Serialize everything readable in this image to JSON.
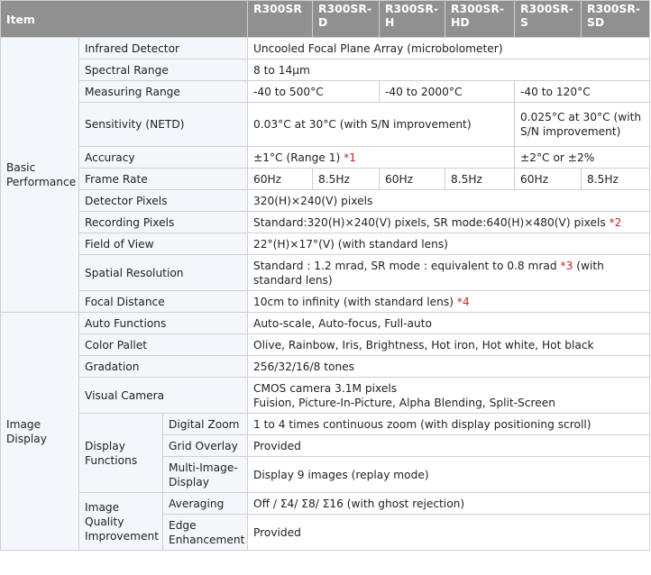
{
  "header": {
    "item": "Item",
    "models": [
      "R300SR",
      "R300SR-D",
      "R300SR-H",
      "R300SR-HD",
      "R300SR-S",
      "R300SR-SD"
    ]
  },
  "basic": {
    "category": "Basic Performance",
    "infrared_detector": {
      "label": "Infrared Detector",
      "value": "Uncooled Focal Plane Array (microbolometer)"
    },
    "spectral_range": {
      "label": "Spectral Range",
      "value": "8 to 14μm"
    },
    "measuring_range": {
      "label": "Measuring Range",
      "v1": "-40 to 500°C",
      "v2": "-40 to 2000°C",
      "v3": "-40 to 120°C"
    },
    "sensitivity": {
      "label": "Sensitivity (NETD)",
      "v1": "0.03°C at 30°C (with S/N improvement)",
      "v2": "0.025°C at 30°C (with S/N improvement)"
    },
    "accuracy": {
      "label": "Accuracy",
      "v1": "±1°C (Range 1) ",
      "v1_note": "*1",
      "v2": "±2°C or ±2%"
    },
    "frame_rate": {
      "label": "Frame Rate",
      "values": [
        "60Hz",
        "8.5Hz",
        "60Hz",
        "8.5Hz",
        "60Hz",
        "8.5Hz"
      ]
    },
    "detector_pixels": {
      "label": "Detector Pixels",
      "value": "320(H)×240(V) pixels"
    },
    "recording_pixels": {
      "label": "Recording Pixels",
      "value": "Standard:320(H)×240(V) pixels, SR mode:640(H)×480(V) pixels ",
      "note": "*2"
    },
    "field_of_view": {
      "label": "Field of View",
      "value": "22°(H)×17°(V) (with standard lens)"
    },
    "spatial_resolution": {
      "label": "Spatial Resolution",
      "value_a": "Standard : 1.2 mrad, SR mode : equivalent to 0.8 mrad ",
      "note": "*3",
      "value_b": " (with standard lens)"
    },
    "focal_distance": {
      "label": "Focal Distance",
      "value": "10cm to infinity (with standard lens) ",
      "note": "*4"
    }
  },
  "image": {
    "category": "Image Display",
    "auto_functions": {
      "label": "Auto Functions",
      "value": "Auto-scale, Auto-focus, Full-auto"
    },
    "color_pallet": {
      "label": "Color Pallet",
      "value": "Olive, Rainbow, Iris, Brightness, Hot iron, Hot white, Hot black"
    },
    "gradation": {
      "label": "Gradation",
      "value": "256/32/16/8 tones"
    },
    "visual_camera": {
      "label": "Visual Camera",
      "line1": "CMOS camera 3.1M pixels",
      "line2": "Fuision, Picture-In-Picture, Alpha Blending, Split-Screen"
    },
    "display_functions": {
      "label": "Display Functions",
      "digital_zoom": {
        "label": "Digital Zoom",
        "value": "1 to 4 times continuous zoom (with display positioning scroll)"
      },
      "grid_overlay": {
        "label": "Grid Overlay",
        "value": "Provided"
      },
      "multi_image": {
        "label": "Multi-Image-Display",
        "value": "Display 9 images (replay mode)"
      }
    },
    "image_quality": {
      "label": "Image Quality Improvement",
      "averaging": {
        "label": "Averaging",
        "value": "Off / Σ4/ Σ8/ Σ16 (with ghost rejection)"
      },
      "edge": {
        "label": "Edge Enhancement",
        "value": "Provided"
      }
    }
  }
}
